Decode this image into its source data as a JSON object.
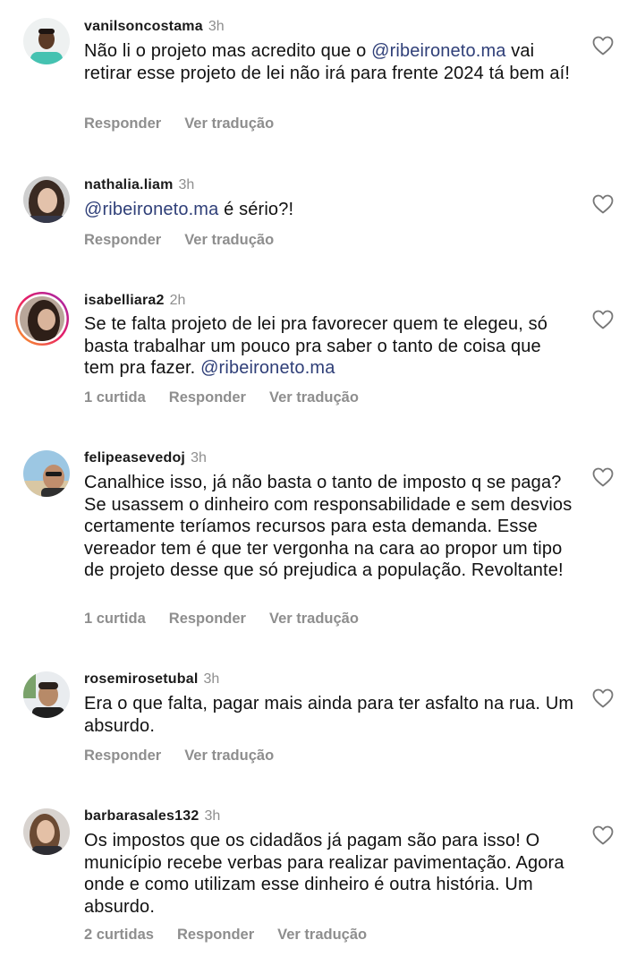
{
  "comments": [
    {
      "username": "vanilsoncostama",
      "time": "3h",
      "text_before": "Não li o projeto mas acredito que o ",
      "mention": "@ribeironeto.ma",
      "text_after": " vai retirar esse projeto de lei não irá para frente 2024 tá bem aí!",
      "likes": "",
      "reply_label": "Responder",
      "translate_label": "Ver tradução"
    },
    {
      "username": "nathalia.liam",
      "time": "3h",
      "text_before": "",
      "mention": "@ribeironeto.ma",
      "text_after": " é sério?!",
      "likes": "",
      "reply_label": "Responder",
      "translate_label": "Ver tradução"
    },
    {
      "username": "isabelliara2",
      "time": "2h",
      "text_before": "Se te falta projeto de lei pra favorecer quem te elegeu, só basta trabalhar um pouco pra saber o tanto de coisa que tem pra fazer. ",
      "mention": "@ribeironeto.ma",
      "text_after": "",
      "likes": "1 curtida",
      "reply_label": "Responder",
      "translate_label": "Ver tradução"
    },
    {
      "username": "felipeasevedoj",
      "time": "3h",
      "text_before": "Canalhice isso, já não basta o tanto de imposto q se paga? Se usassem o dinheiro com responsabilidade e sem desvios certamente teríamos recursos para esta demanda. Esse vereador tem é que ter vergonha na cara ao propor um tipo de projeto desse que só prejudica a população. Revoltante!",
      "mention": "",
      "text_after": "",
      "likes": "1 curtida",
      "reply_label": "Responder",
      "translate_label": "Ver tradução"
    },
    {
      "username": "rosemirosetubal",
      "time": "3h",
      "text_before": "Era o que falta, pagar mais ainda para ter asfalto na rua. Um absurdo.",
      "mention": "",
      "text_after": "",
      "likes": "",
      "reply_label": "Responder",
      "translate_label": "Ver tradução"
    },
    {
      "username": "barbarasales132",
      "time": "3h",
      "text_before": "Os impostos que os cidadãos já pagam são para isso! O município recebe verbas para realizar pavimentação. Agora onde e como utilizam esse dinheiro é outra história. Um absurdo.",
      "mention": "",
      "text_after": "",
      "likes": "2 curtidas",
      "reply_label": "Responder",
      "translate_label": "Ver tradução"
    }
  ],
  "colors": {
    "mention": "#2f3f78",
    "meta": "#8e8e8e",
    "text": "#111111"
  },
  "icons": {
    "like": "heart-outline-icon",
    "avatar": "user-avatar"
  }
}
